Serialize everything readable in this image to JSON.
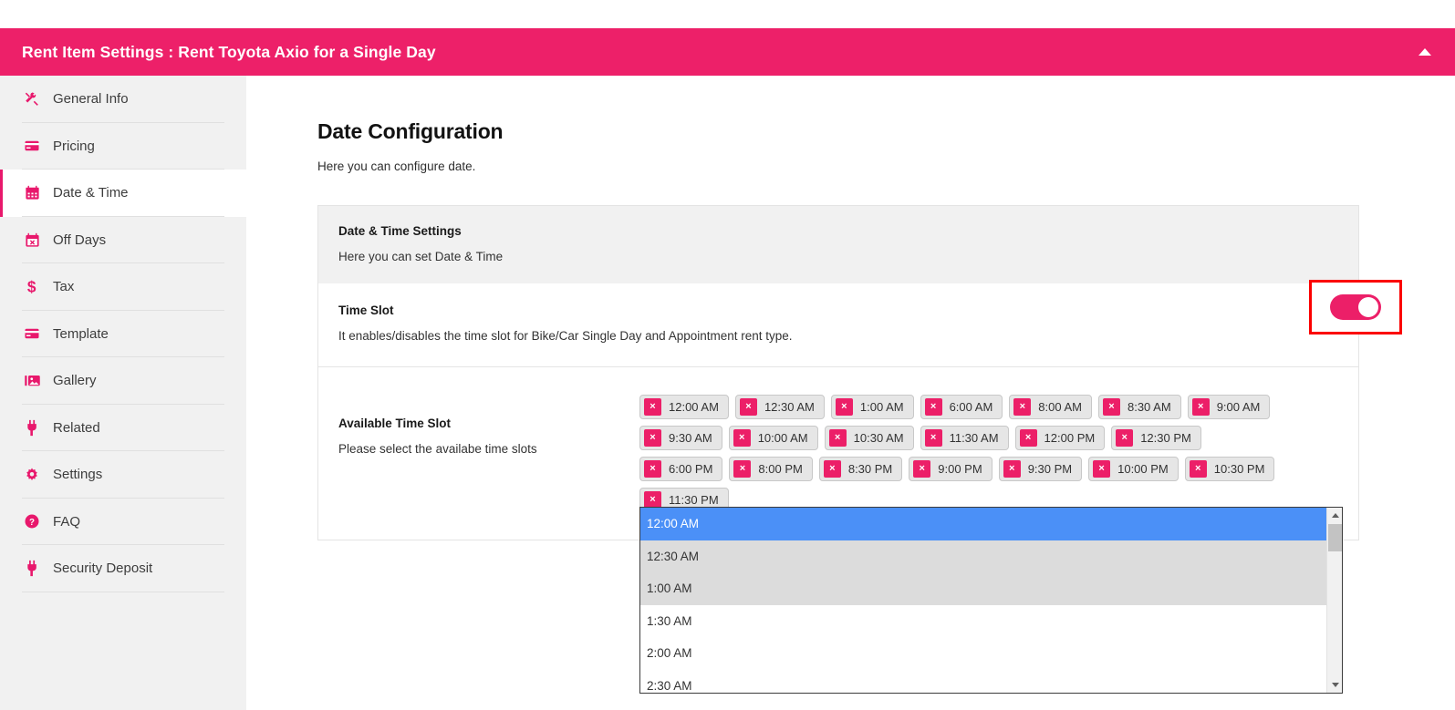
{
  "header": {
    "title": "Rent Item Settings : Rent Toyota Axio for a Single Day",
    "collapse_icon": "caret-up-icon",
    "bg_color": "#ed2069"
  },
  "sidebar": {
    "items": [
      {
        "label": "General Info",
        "icon": "tools-icon",
        "active": false
      },
      {
        "label": "Pricing",
        "icon": "credit-card-icon",
        "active": false
      },
      {
        "label": "Date & Time",
        "icon": "calendar-icon",
        "active": true
      },
      {
        "label": "Off Days",
        "icon": "calendar-x-icon",
        "active": false
      },
      {
        "label": "Tax",
        "icon": "dollar-icon",
        "active": false
      },
      {
        "label": "Template",
        "icon": "credit-card-icon",
        "active": false
      },
      {
        "label": "Gallery",
        "icon": "image-icon",
        "active": false
      },
      {
        "label": "Related",
        "icon": "plug-icon",
        "active": false
      },
      {
        "label": "Settings",
        "icon": "gear-icon",
        "active": false
      },
      {
        "label": "FAQ",
        "icon": "question-circle-icon",
        "active": false
      },
      {
        "label": "Security Deposit",
        "icon": "plug-icon",
        "active": false
      }
    ]
  },
  "main": {
    "page_title": "Date Configuration",
    "page_subtitle": "Here you can configure date.",
    "card": {
      "head_title": "Date & Time Settings",
      "head_subtitle": "Here you can set Date & Time",
      "time_slot": {
        "title": "Time Slot",
        "subtitle": "It enables/disables the time slot for Bike/Car Single Day and Appointment rent type.",
        "toggle_state": "on",
        "toggle_color": "#ec1f68",
        "highlight_color": "#fb0000"
      },
      "available_time_slot": {
        "title": "Available Time Slot",
        "subtitle": "Please select the availabe time slots",
        "chips": [
          "12:00 AM",
          "12:30 AM",
          "1:00 AM",
          "6:00 AM",
          "8:00 AM",
          "8:30 AM",
          "9:00 AM",
          "9:30 AM",
          "10:00 AM",
          "10:30 AM",
          "11:30 AM",
          "12:00 PM",
          "12:30 PM",
          "6:00 PM",
          "8:00 PM",
          "8:30 PM",
          "9:00 PM",
          "9:30 PM",
          "10:00 PM",
          "10:30 PM",
          "11:30 PM"
        ],
        "chip_remove_label": "×",
        "dropdown": {
          "options": [
            {
              "label": "12:00 AM",
              "state": "selected"
            },
            {
              "label": "12:30 AM",
              "state": "shaded"
            },
            {
              "label": "1:00 AM",
              "state": "shaded"
            },
            {
              "label": "1:30 AM",
              "state": "normal"
            },
            {
              "label": "2:00 AM",
              "state": "normal"
            },
            {
              "label": "2:30 AM",
              "state": "normal"
            }
          ],
          "selected_color": "#4b90f7",
          "scroll_up_icon": "caret-up-icon",
          "scroll_down_icon": "caret-down-icon"
        }
      }
    }
  }
}
